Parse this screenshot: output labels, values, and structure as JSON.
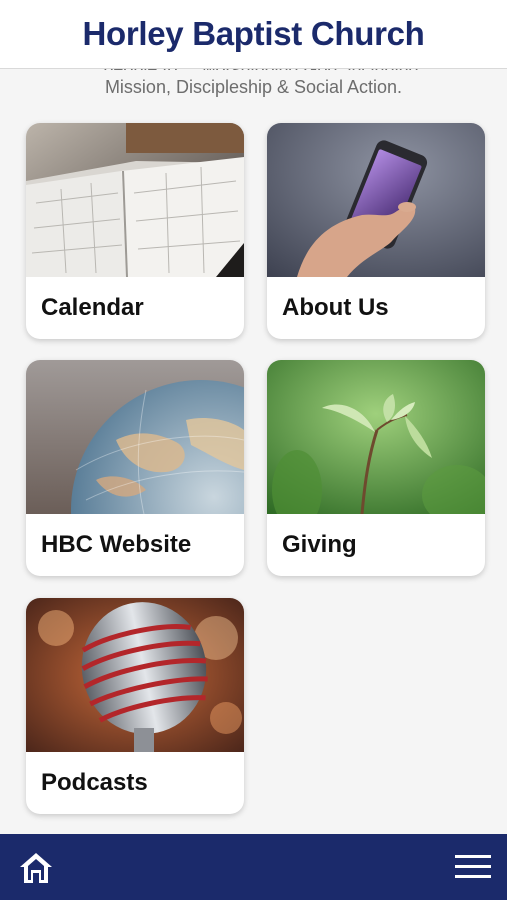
{
  "header": {
    "title": "Horley Baptist Church"
  },
  "intro": {
    "partial_line": "...people to ... worshipping God, including",
    "line": "Mission, Discipleship & Social Action."
  },
  "tiles": [
    {
      "label": "Calendar",
      "image": "open-diary-photo"
    },
    {
      "label": "About Us",
      "image": "hand-holding-phone-photo"
    },
    {
      "label": "HBC Website",
      "image": "globe-photo"
    },
    {
      "label": "Giving",
      "image": "seedling-photo"
    },
    {
      "label": "Podcasts",
      "image": "microphone-photo"
    }
  ],
  "footer": {
    "home_icon": "home-icon",
    "menu_icon": "hamburger-menu-icon"
  },
  "colors": {
    "brand_navy": "#1b2a6b",
    "background": "#f5f5f5",
    "card": "#ffffff",
    "intro_text": "#6d6d6d"
  }
}
